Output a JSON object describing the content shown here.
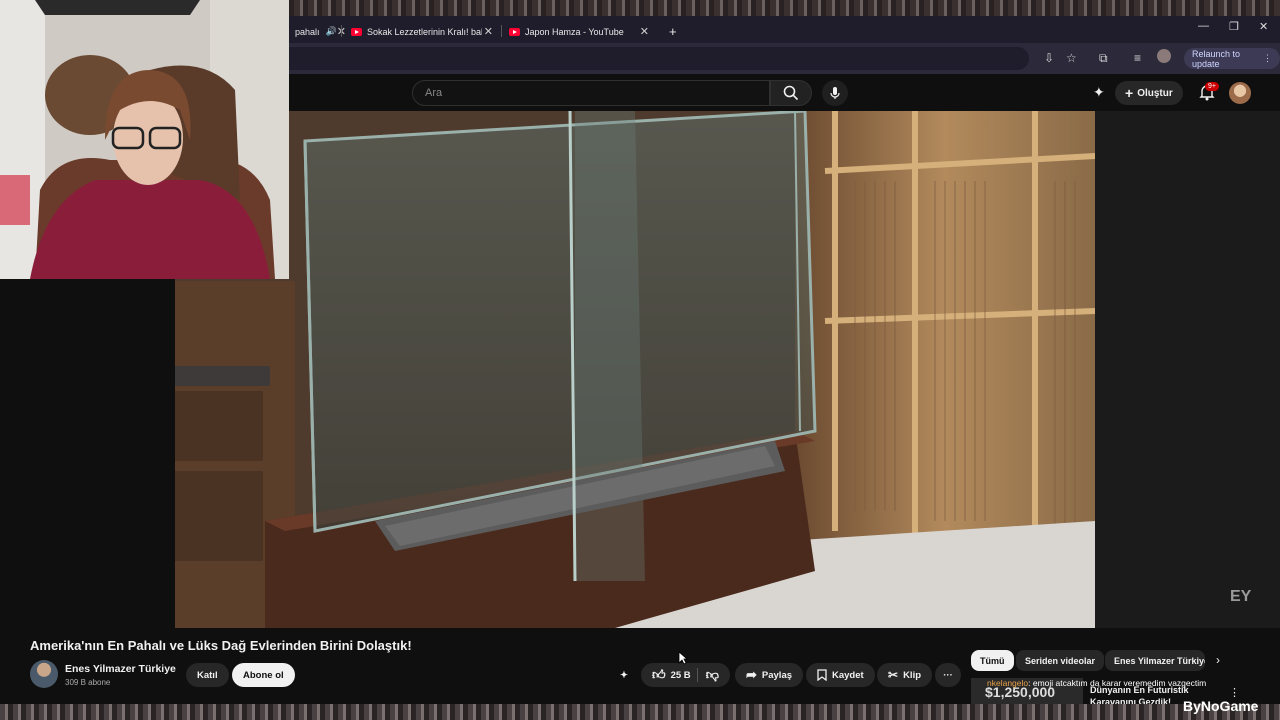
{
  "browser": {
    "tabs": [
      {
        "label": "Sokak Lezzetlerinin Kralı! bahar"
      },
      {
        "label": "Japon Hamza - YouTube"
      }
    ],
    "partial_tab_label": "pahalı",
    "new_tab_label": "+",
    "relaunch_label": "Relaunch to update",
    "window_controls": [
      "—",
      "❐",
      "✕"
    ]
  },
  "youtube": {
    "search_placeholder": "Ara",
    "create_label": "Oluştur",
    "notification_count": "9+"
  },
  "video": {
    "title": "Amerika'nın En Pahalı ve Lüks Dağ Evlerinden Birini Dolaştık!",
    "watermark": "EY",
    "channel_name": "Enes Yilmazer Türkiye",
    "subscribers": "309 B abone",
    "join_label": "Katıl",
    "subscribe_label": "Abone ol",
    "like_count": "25 B",
    "share_label": "Paylaş",
    "save_label": "Kaydet",
    "clip_label": "Klip",
    "more_label": "···"
  },
  "chips": {
    "all": "Tümü",
    "series": "Seriden videolar",
    "channel": "Enes Yilmazer Türkiye",
    "next": "›"
  },
  "recommendation": {
    "price": "$1,250,000",
    "title": "Dünyanın En Futuristik Karavanını Gezdik!",
    "more": "⋮"
  },
  "chat": {
    "user": "nkelangelo",
    "message": ": emoji atcaktım da karar veremedim vazgectim"
  },
  "overlay": {
    "brand": "ByNoGame"
  },
  "colors": {
    "accent": "#ff0033",
    "badge": "#cc0000",
    "tab_bar": "#1f1d2b"
  }
}
